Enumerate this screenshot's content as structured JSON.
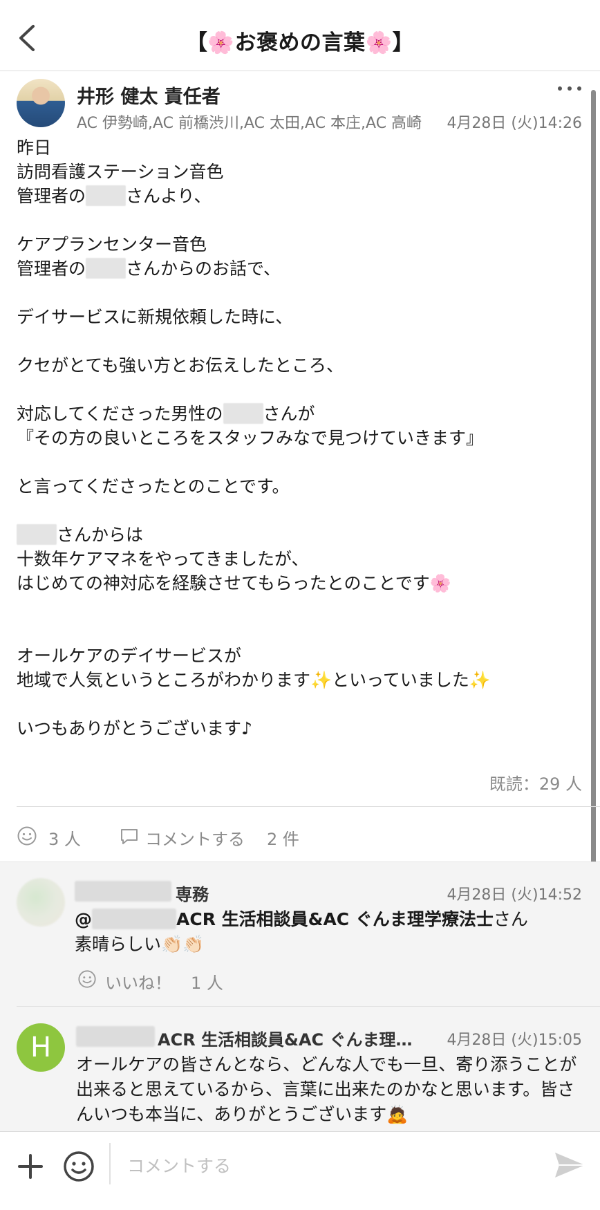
{
  "header": {
    "title": "【🌸お褒めの言葉🌸】"
  },
  "post": {
    "author_name": "井形 健太 責任者",
    "author_meta": "AC 伊勢崎,AC 前橋渋川,AC 太田,AC 本庄,AC 高崎",
    "time": "4月28日 (火)14:26",
    "lines": {
      "l1": "昨日",
      "l2": "訪問看護ステーション音色",
      "l3a": "管理者の",
      "l3b": "さんより、",
      "l5": "ケアプランセンター音色",
      "l6a": "管理者の",
      "l6b": "さんからのお話で、",
      "l8": "デイサービスに新規依頼した時に、",
      "l10": "クセがとても強い方とお伝えしたところ、",
      "l12a": "対応してくださった男性の",
      "l12b": "さんが",
      "l13": "『その方の良いところをスタッフみなで見つけていきます』",
      "l15": "と言ってくださったとのことです。",
      "l17b": "さんからは",
      "l18": "十数年ケアマネをやってきましたが、",
      "l19": "はじめての神対応を経験させてもらったとのことです🌸",
      "l22": "オールケアのデイサービスが",
      "l23": "地域で人気というところがわかります✨といっていました✨",
      "l25": "いつもありがとうございます♪"
    },
    "read_count": "既読：29 人",
    "like_count": "3 人",
    "comment_label": "コメントする",
    "comment_count": "2 件"
  },
  "comments": [
    {
      "role": "専務",
      "time": "4月28日 (火)14:52",
      "mention_prefix": "@",
      "mention_suffix": "ACR 生活相談員&AC ぐんま理学療法士",
      "mention_tail": "さん",
      "text": "素晴らしい👏🏻👏🏻",
      "like_label": "いいね！",
      "like_count": "1 人"
    },
    {
      "avatar_letter": "H",
      "role": "ACR 生活相談員&AC ぐんま理学療法士",
      "time": "4月28日 (火)15:05",
      "text": "オールケアの皆さんとなら、どんな人でも一旦、寄り添うことが出来ると思えているから、言葉に出来たのかなと思います。皆さんいつも本当に、ありがとうございます🙇"
    }
  ],
  "input_bar": {
    "placeholder": "コメントする"
  },
  "colors": {
    "accent_green": "#8ec63f",
    "muted_text": "#777777",
    "comment_bg": "#f4f4f4"
  }
}
